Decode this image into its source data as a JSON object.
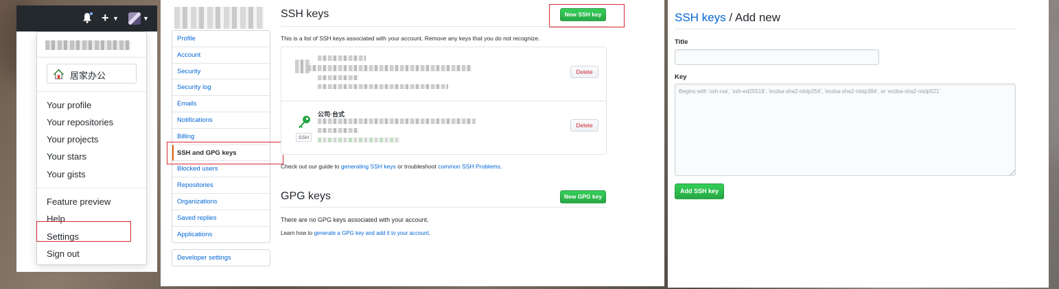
{
  "user_menu": {
    "status_label": "居家办公",
    "items": [
      "Your profile",
      "Your repositories",
      "Your projects",
      "Your stars",
      "Your gists"
    ],
    "items2": [
      "Feature preview",
      "Help",
      "Settings",
      "Sign out"
    ]
  },
  "settings_nav": {
    "items": [
      "Profile",
      "Account",
      "Security",
      "Security log",
      "Emails",
      "Notifications",
      "Billing",
      "SSH and GPG keys",
      "Blocked users",
      "Repositories",
      "Organizations",
      "Saved replies",
      "Applications"
    ],
    "active": "SSH and GPG keys",
    "developer": "Developer settings"
  },
  "ssh": {
    "heading": "SSH keys",
    "new_button": "New SSH key",
    "description": "This is a list of SSH keys associated with your account. Remove any keys that you do not recognize.",
    "keys": [
      {
        "title": "",
        "badge": "",
        "delete_label": "Delete"
      },
      {
        "title": "公司·台式",
        "badge": "SSH",
        "delete_label": "Delete"
      }
    ],
    "guide_pre": "Check out our guide to ",
    "guide_link1": "generating SSH keys",
    "guide_mid": " or troubleshoot ",
    "guide_link2": "common SSH Problems",
    "guide_end": "."
  },
  "gpg": {
    "heading": "GPG keys",
    "new_button": "New GPG key",
    "empty": "There are no GPG keys associated with your account.",
    "learn_pre": "Learn how to ",
    "learn_link": "generate a GPG key and add it to your account",
    "learn_end": "."
  },
  "add_new": {
    "breadcrumb_link": "SSH keys",
    "breadcrumb_sep": " / ",
    "breadcrumb_current": "Add new",
    "title_label": "Title",
    "key_label": "Key",
    "key_placeholder": "Begins with 'ssh-rsa', 'ssh-ed25519', 'ecdsa-sha2-nistp256', 'ecdsa-sha2-nistp384', or 'ecdsa-sha2-nistp521'",
    "submit": "Add SSH key"
  },
  "colors": {
    "accent_green": "#28a745",
    "link_blue": "#0366d6",
    "highlight_red": "#d7262e",
    "header_dark": "#24292e"
  }
}
